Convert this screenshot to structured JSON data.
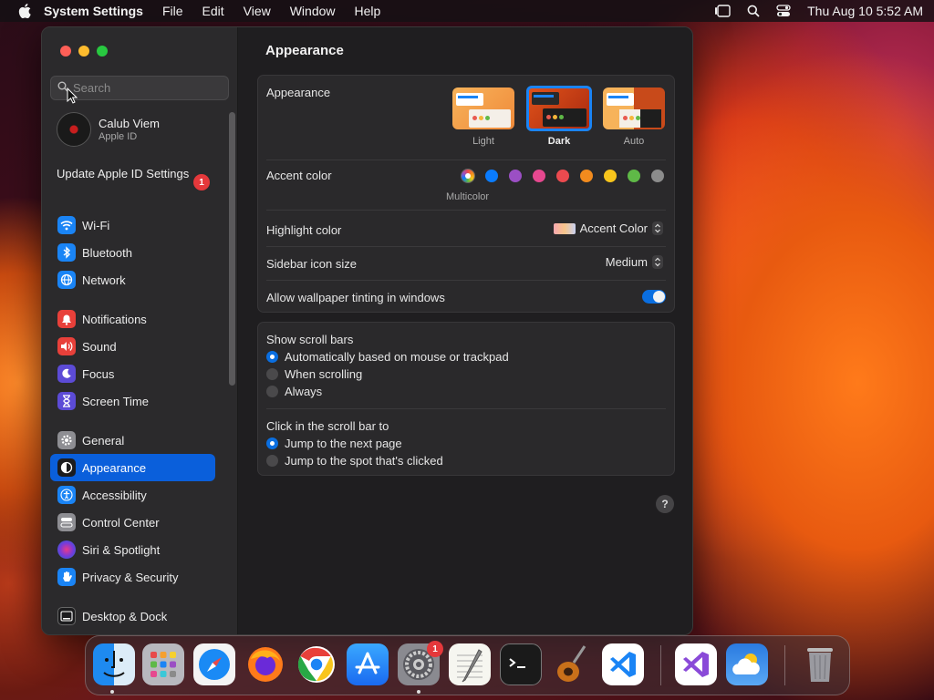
{
  "menubar": {
    "app_name": "System Settings",
    "items": [
      "File",
      "Edit",
      "View",
      "Window",
      "Help"
    ],
    "clock": "Thu Aug 10  5:52 AM"
  },
  "sidebar": {
    "search_placeholder": "Search",
    "profile": {
      "name": "Calub Viem",
      "subtitle": "Apple ID"
    },
    "update": {
      "label": "Update Apple ID Settings",
      "badge": "1"
    },
    "groups": [
      [
        {
          "label": "Wi-Fi",
          "icon": "wifi-icon",
          "color": "#1a84f5"
        },
        {
          "label": "Bluetooth",
          "icon": "bluetooth-icon",
          "color": "#1a84f5"
        },
        {
          "label": "Network",
          "icon": "globe-icon",
          "color": "#1a84f5"
        }
      ],
      [
        {
          "label": "Notifications",
          "icon": "bell-icon",
          "color": "#e8403a"
        },
        {
          "label": "Sound",
          "icon": "speaker-icon",
          "color": "#e8403a"
        },
        {
          "label": "Focus",
          "icon": "moon-icon",
          "color": "#5c4bd6"
        },
        {
          "label": "Screen Time",
          "icon": "hourglass-icon",
          "color": "#5c4bd6"
        }
      ],
      [
        {
          "label": "General",
          "icon": "gear-icon",
          "color": "#8e8e93"
        },
        {
          "label": "Appearance",
          "icon": "appearance-icon",
          "color": "#1c1c1e",
          "selected": true
        },
        {
          "label": "Accessibility",
          "icon": "accessibility-icon",
          "color": "#1a84f5"
        },
        {
          "label": "Control Center",
          "icon": "control-center-icon",
          "color": "#8e8e93"
        },
        {
          "label": "Siri & Spotlight",
          "icon": "siri-icon",
          "color": "#b03ad8"
        },
        {
          "label": "Privacy & Security",
          "icon": "hand-icon",
          "color": "#1a84f5"
        }
      ],
      [
        {
          "label": "Desktop & Dock",
          "icon": "dock-icon",
          "color": "#1c1c1e"
        }
      ]
    ]
  },
  "content": {
    "title": "Appearance",
    "appearance": {
      "label": "Appearance",
      "options": [
        {
          "label": "Light",
          "active": false
        },
        {
          "label": "Dark",
          "active": true
        },
        {
          "label": "Auto",
          "active": false
        }
      ]
    },
    "accent": {
      "label": "Accent color",
      "colors": [
        "multicolor",
        "#0a7cff",
        "#9b4fc4",
        "#e6488f",
        "#ec4a4f",
        "#f28b1e",
        "#f8c51c",
        "#5fb947",
        "#8c8c8c"
      ],
      "selected_label": "Multicolor"
    },
    "highlight": {
      "label": "Highlight color",
      "value": "Accent Color"
    },
    "sidebar_icon_size": {
      "label": "Sidebar icon size",
      "value": "Medium"
    },
    "wallpaper_tinting": {
      "label": "Allow wallpaper tinting in windows",
      "on": true
    },
    "scroll_bars": {
      "label": "Show scroll bars",
      "options": [
        {
          "label": "Automatically based on mouse or trackpad",
          "selected": true
        },
        {
          "label": "When scrolling",
          "selected": false
        },
        {
          "label": "Always",
          "selected": false
        }
      ]
    },
    "scroll_click": {
      "label": "Click in the scroll bar to",
      "options": [
        {
          "label": "Jump to the next page",
          "selected": true
        },
        {
          "label": "Jump to the spot that's clicked",
          "selected": false
        }
      ]
    },
    "help": "?"
  },
  "dock": {
    "apps": [
      "Finder",
      "Launchpad",
      "Safari",
      "Firefox",
      "Chrome",
      "App Store",
      "System Settings",
      "TextEdit",
      "Terminal",
      "GarageBand",
      "Visual Studio Code",
      "Visual Studio",
      "Weather",
      "Trash"
    ],
    "settings_badge": "1"
  }
}
